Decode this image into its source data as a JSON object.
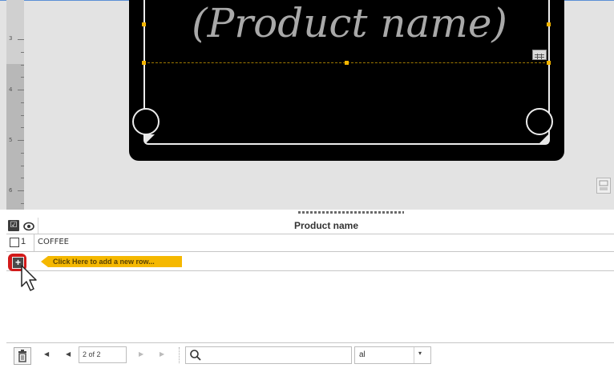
{
  "ruler": {
    "marks": [
      "3",
      "4",
      "5",
      "6"
    ]
  },
  "label": {
    "product_placeholder": "(Product name)"
  },
  "grid": {
    "header": {
      "check_glyph": "☑",
      "eye_icon": "eye-icon",
      "column_title": "Product name"
    },
    "rows": [
      {
        "number": "1",
        "value": "COFFEE"
      }
    ],
    "add_row": {
      "plus_glyph": "+",
      "hint": "Click Here to add a new row..."
    }
  },
  "toolbar": {
    "first_glyph": "◀",
    "prev_glyph": "◀",
    "page_value": "2 of 2",
    "next_glyph": "▶",
    "last_glyph": "▶",
    "search_value": "",
    "filter_value": "al",
    "caret_glyph": "▾"
  },
  "colors": {
    "accent_hint": "#f5b800",
    "highlight_ring": "#d21a1a",
    "handle": "#f5b500"
  }
}
